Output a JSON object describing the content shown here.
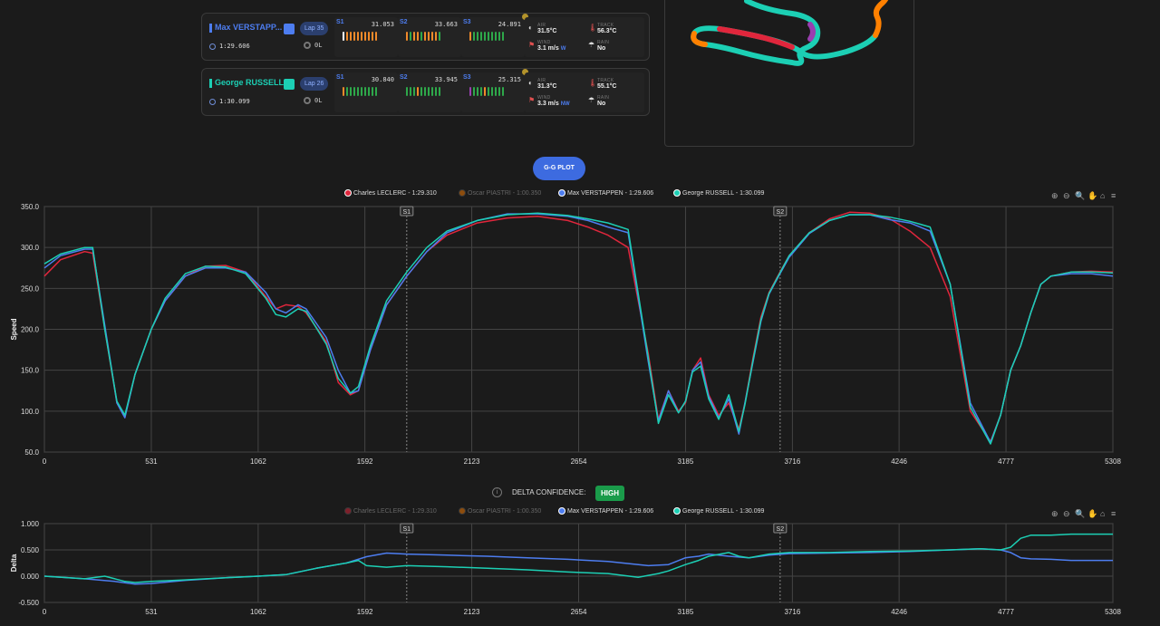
{
  "drivers": [
    {
      "name": "Max VERSTAPP...",
      "color": "#4d7df0",
      "lap": "Lap 35",
      "lap_time": "1:29.606",
      "tyre_age": "0L",
      "sectors": [
        {
          "label": "S1",
          "time": "31.053",
          "mini": [
            "#ffffff",
            "#f08a2a",
            "#f08a2a",
            "#f08a2a",
            "#f08a2a",
            "#f08a2a",
            "#f08a2a",
            "#f08a2a",
            "#f08a2a",
            "#f08a2a"
          ]
        },
        {
          "label": "S2",
          "time": "33.663",
          "mini": [
            "#f08a2a",
            "#2ea84a",
            "#f08a2a",
            "#f08a2a",
            "#2ea84a",
            "#f08a2a",
            "#f08a2a",
            "#f08a2a",
            "#f08a2a",
            "#2ea84a"
          ]
        },
        {
          "label": "S3",
          "time": "24.891",
          "mini": [
            "#f08a2a",
            "#2ea84a",
            "#2ea84a",
            "#2ea84a",
            "#2ea84a",
            "#2ea84a",
            "#2ea84a",
            "#2ea84a",
            "#2ea84a",
            "#2ea84a"
          ]
        }
      ],
      "weather": {
        "air_label": "AIR",
        "air": "31.5°C",
        "track_label": "TRACK",
        "track": "56.3°C",
        "wind_label": "WIND",
        "wind": "3.1 m/s",
        "wind_dir": "W",
        "rain_label": "RAIN",
        "rain": "No"
      }
    },
    {
      "name": "George RUSSELL",
      "color": "#1ccfb4",
      "lap": "Lap 26",
      "lap_time": "1:30.099",
      "tyre_age": "0L",
      "sectors": [
        {
          "label": "S1",
          "time": "30.840",
          "mini": [
            "#f08a2a",
            "#2ea84a",
            "#2ea84a",
            "#2ea84a",
            "#2ea84a",
            "#2ea84a",
            "#2ea84a",
            "#2ea84a",
            "#2ea84a",
            "#2ea84a"
          ]
        },
        {
          "label": "S2",
          "time": "33.945",
          "mini": [
            "#2ea84a",
            "#2ea84a",
            "#2ea84a",
            "#f08a2a",
            "#2ea84a",
            "#2ea84a",
            "#2ea84a",
            "#2ea84a",
            "#2ea84a",
            "#2ea84a"
          ]
        },
        {
          "label": "S3",
          "time": "25.315",
          "mini": [
            "#9a3fb0",
            "#2ea84a",
            "#2ea84a",
            "#2ea84a",
            "#f08a2a",
            "#2ea84a",
            "#2ea84a",
            "#2ea84a",
            "#2ea84a",
            "#2ea84a"
          ]
        }
      ],
      "weather": {
        "air_label": "AIR",
        "air": "31.3°C",
        "track_label": "TRACK",
        "track": "55.1°C",
        "wind_label": "WIND",
        "wind": "3.3 m/s",
        "wind_dir": "NW",
        "rain_label": "RAIN",
        "rain": "No"
      }
    }
  ],
  "gg_plot_button": "G-G PLOT",
  "delta_confidence": {
    "label": "DELTA CONFIDENCE:",
    "value": "HIGH"
  },
  "legend": [
    {
      "name": "Charles LECLERC - 1:29.310",
      "color": "#e0263c"
    },
    {
      "name": "Oscar PIASTRI - 1:00.350",
      "color": "#ff8000"
    },
    {
      "name": "Max VERSTAPPEN - 1:29.606",
      "color": "#4d7df0"
    },
    {
      "name": "George RUSSELL - 1:30.099",
      "color": "#1ccfb4"
    }
  ],
  "chart_data": [
    {
      "type": "line",
      "ylabel": "Speed",
      "ylim": [
        50,
        350
      ],
      "xlim": [
        0,
        5308
      ],
      "x_ticks": [
        0,
        531,
        1062,
        1592,
        2123,
        2654,
        3185,
        3716,
        4246,
        4777,
        5308
      ],
      "y_ticks": [
        50.0,
        100.0,
        150.0,
        200.0,
        250.0,
        300.0,
        350.0
      ],
      "sector_markers": [
        {
          "label": "S1",
          "x": 1800
        },
        {
          "label": "S2",
          "x": 3655
        }
      ],
      "series": [
        {
          "name": "Charles LECLERC - 1:29.310",
          "visible": true,
          "color": "#e0263c",
          "x": [
            0,
            80,
            200,
            240,
            300,
            360,
            400,
            450,
            531,
            600,
            700,
            800,
            900,
            1000,
            1100,
            1150,
            1200,
            1260,
            1300,
            1400,
            1460,
            1520,
            1560,
            1620,
            1700,
            1800,
            1900,
            2000,
            2150,
            2300,
            2450,
            2600,
            2700,
            2800,
            2900,
            3000,
            3050,
            3100,
            3150,
            3185,
            3220,
            3260,
            3300,
            3350,
            3400,
            3450,
            3480,
            3520,
            3560,
            3600,
            3650,
            3700,
            3800,
            3900,
            4000,
            4100,
            4200,
            4300,
            4400,
            4500,
            4600,
            4700,
            4750,
            4800,
            4850,
            4900,
            4950,
            5000,
            5100,
            5200,
            5308
          ],
          "y": [
            265,
            285,
            295,
            293,
            200,
            110,
            93,
            145,
            200,
            235,
            265,
            277,
            278,
            270,
            240,
            225,
            230,
            228,
            220,
            185,
            135,
            120,
            125,
            175,
            230,
            265,
            295,
            315,
            330,
            336,
            338,
            333,
            325,
            315,
            300,
            170,
            90,
            125,
            100,
            110,
            150,
            165,
            120,
            95,
            110,
            78,
            110,
            165,
            215,
            245,
            268,
            290,
            318,
            335,
            343,
            342,
            335,
            320,
            300,
            240,
            100,
            63,
            95,
            150,
            180,
            220,
            255,
            265,
            270,
            271,
            270
          ]
        },
        {
          "name": "Oscar PIASTRI - 1:00.350",
          "visible": false,
          "color": "#ff8000",
          "x": [],
          "y": []
        },
        {
          "name": "Max VERSTAPPEN - 1:29.606",
          "visible": true,
          "color": "#4d7df0",
          "x": [
            0,
            80,
            200,
            240,
            300,
            360,
            400,
            450,
            531,
            600,
            700,
            800,
            900,
            1000,
            1100,
            1150,
            1200,
            1260,
            1300,
            1400,
            1460,
            1520,
            1560,
            1620,
            1700,
            1800,
            1900,
            2000,
            2150,
            2300,
            2450,
            2600,
            2700,
            2800,
            2900,
            3000,
            3050,
            3100,
            3150,
            3185,
            3220,
            3260,
            3300,
            3350,
            3400,
            3450,
            3480,
            3520,
            3560,
            3600,
            3650,
            3700,
            3800,
            3900,
            4000,
            4100,
            4200,
            4300,
            4400,
            4500,
            4600,
            4700,
            4750,
            4800,
            4850,
            4900,
            4950,
            5000,
            5100,
            5200,
            5308
          ],
          "y": [
            275,
            290,
            298,
            298,
            205,
            110,
            92,
            145,
            200,
            235,
            265,
            275,
            275,
            270,
            245,
            225,
            220,
            230,
            225,
            190,
            150,
            122,
            125,
            175,
            230,
            265,
            295,
            318,
            333,
            341,
            341,
            338,
            333,
            325,
            318,
            160,
            88,
            125,
            98,
            112,
            150,
            160,
            118,
            92,
            115,
            72,
            110,
            160,
            210,
            243,
            266,
            288,
            317,
            333,
            340,
            340,
            334,
            330,
            320,
            255,
            110,
            62,
            95,
            150,
            180,
            220,
            255,
            265,
            268,
            268,
            265
          ]
        },
        {
          "name": "George RUSSELL - 1:30.099",
          "visible": true,
          "color": "#1ccfb4",
          "x": [
            0,
            80,
            200,
            240,
            300,
            360,
            400,
            450,
            531,
            600,
            700,
            800,
            900,
            1000,
            1100,
            1150,
            1200,
            1260,
            1300,
            1400,
            1460,
            1520,
            1560,
            1620,
            1700,
            1800,
            1900,
            2000,
            2150,
            2300,
            2450,
            2600,
            2700,
            2800,
            2900,
            3000,
            3050,
            3100,
            3150,
            3185,
            3220,
            3260,
            3300,
            3350,
            3400,
            3450,
            3480,
            3520,
            3560,
            3600,
            3650,
            3700,
            3800,
            3900,
            4000,
            4100,
            4200,
            4300,
            4400,
            4500,
            4600,
            4700,
            4750,
            4800,
            4850,
            4900,
            4950,
            5000,
            5100,
            5200,
            5308
          ],
          "y": [
            280,
            292,
            300,
            300,
            200,
            112,
            95,
            145,
            200,
            238,
            268,
            277,
            276,
            268,
            238,
            218,
            215,
            225,
            222,
            182,
            140,
            122,
            130,
            180,
            235,
            270,
            300,
            320,
            333,
            340,
            342,
            339,
            335,
            330,
            322,
            165,
            85,
            120,
            98,
            112,
            148,
            155,
            115,
            90,
            120,
            75,
            108,
            162,
            212,
            244,
            267,
            290,
            318,
            333,
            340,
            340,
            337,
            332,
            325,
            255,
            105,
            60,
            95,
            150,
            180,
            220,
            255,
            265,
            270,
            270,
            269
          ]
        }
      ]
    },
    {
      "type": "line",
      "ylabel": "Delta",
      "ylim": [
        -0.5,
        1.0
      ],
      "xlim": [
        0,
        5308
      ],
      "x_ticks": [
        0,
        531,
        1062,
        1592,
        2123,
        2654,
        3185,
        3716,
        4246,
        4777,
        5308
      ],
      "y_ticks": [
        -0.5,
        0.0,
        0.5,
        1.0
      ],
      "y_tick_labels": [
        "-0.500",
        "0.000",
        "0.500",
        "1.000"
      ],
      "sector_markers": [
        {
          "label": "S1",
          "x": 1800
        },
        {
          "label": "S2",
          "x": 3655
        }
      ],
      "series": [
        {
          "name": "Charles LECLERC - 1:29.310",
          "visible": false,
          "color": "#e0263c",
          "x": [],
          "y": []
        },
        {
          "name": "Oscar PIASTRI - 1:00.350",
          "visible": false,
          "color": "#ff8000",
          "x": [],
          "y": []
        },
        {
          "name": "Max VERSTAPPEN - 1:29.606",
          "visible": true,
          "color": "#4d7df0",
          "x": [
            0,
            200,
            350,
            450,
            531,
            700,
            900,
            1062,
            1200,
            1350,
            1500,
            1600,
            1700,
            1800,
            2000,
            2200,
            2400,
            2600,
            2800,
            3000,
            3100,
            3185,
            3250,
            3300,
            3400,
            3500,
            3600,
            3700,
            3900,
            4100,
            4300,
            4500,
            4650,
            4750,
            4800,
            4850,
            4900,
            5000,
            5100,
            5200,
            5308
          ],
          "y": [
            0,
            -0.05,
            -0.1,
            -0.15,
            -0.14,
            -0.08,
            -0.03,
            0.0,
            0.03,
            0.15,
            0.25,
            0.37,
            0.44,
            0.42,
            0.4,
            0.38,
            0.35,
            0.32,
            0.28,
            0.2,
            0.22,
            0.35,
            0.38,
            0.42,
            0.38,
            0.35,
            0.4,
            0.43,
            0.44,
            0.45,
            0.47,
            0.5,
            0.52,
            0.5,
            0.45,
            0.35,
            0.33,
            0.32,
            0.3,
            0.3,
            0.3
          ]
        },
        {
          "name": "George RUSSELL - 1:30.099",
          "visible": true,
          "color": "#1ccfb4",
          "x": [
            0,
            200,
            300,
            350,
            400,
            450,
            531,
            700,
            900,
            1062,
            1200,
            1350,
            1500,
            1560,
            1600,
            1700,
            1800,
            2000,
            2200,
            2400,
            2600,
            2800,
            2950,
            3050,
            3100,
            3185,
            3250,
            3300,
            3400,
            3450,
            3500,
            3600,
            3700,
            3900,
            4100,
            4300,
            4500,
            4650,
            4750,
            4800,
            4850,
            4900,
            5000,
            5100,
            5200,
            5308
          ],
          "y": [
            0,
            -0.05,
            0.0,
            -0.05,
            -0.1,
            -0.12,
            -0.1,
            -0.07,
            -0.03,
            0.0,
            0.03,
            0.15,
            0.25,
            0.3,
            0.2,
            0.17,
            0.2,
            0.18,
            0.15,
            0.12,
            0.08,
            0.05,
            -0.02,
            0.05,
            0.1,
            0.22,
            0.3,
            0.38,
            0.45,
            0.38,
            0.35,
            0.42,
            0.45,
            0.45,
            0.47,
            0.48,
            0.5,
            0.52,
            0.5,
            0.55,
            0.72,
            0.78,
            0.78,
            0.8,
            0.8,
            0.8
          ]
        }
      ]
    }
  ]
}
